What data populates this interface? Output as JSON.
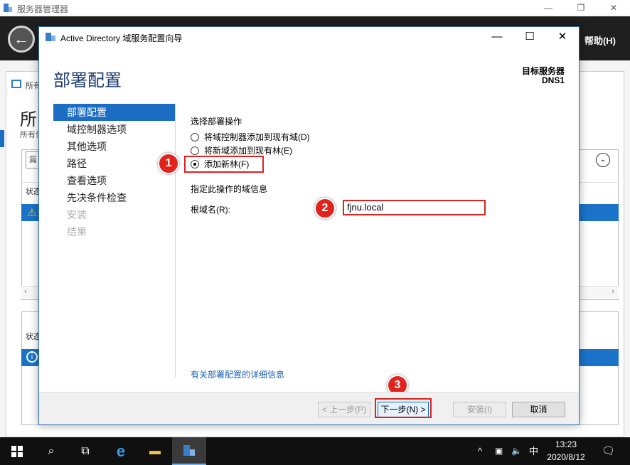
{
  "server_manager": {
    "title": "服务器管理器",
    "help_menu": "帮助(H)",
    "panel_label": "所有",
    "big_title": "所",
    "sub_title": "所有伺",
    "filter_placeholder": "篇",
    "status_col": "状态",
    "status_col2": "状态"
  },
  "wizard": {
    "window_title": "Active Directory 域服务配置向导",
    "page_title": "部署配置",
    "target_label": "目标服务器",
    "target_name": "DNS1",
    "nav": [
      {
        "label": "部署配置",
        "state": "active"
      },
      {
        "label": "域控制器选项",
        "state": "normal"
      },
      {
        "label": "其他选项",
        "state": "normal"
      },
      {
        "label": "路径",
        "state": "normal"
      },
      {
        "label": "查看选项",
        "state": "normal"
      },
      {
        "label": "先决条件检查",
        "state": "normal"
      },
      {
        "label": "安装",
        "state": "disabled"
      },
      {
        "label": "结果",
        "state": "disabled"
      }
    ],
    "operation_heading": "选择部署操作",
    "options": [
      {
        "label": "将域控制器添加到现有域(D)",
        "selected": false
      },
      {
        "label": "将新域添加到现有林(E)",
        "selected": false
      },
      {
        "label": "添加新林(F)",
        "selected": true
      }
    ],
    "domain_info_heading": "指定此操作的域信息",
    "root_domain_label": "根域名(R):",
    "root_domain_value": "fjnu.local",
    "more_info_link": "有关部署配置的详细信息",
    "buttons": {
      "prev": "< 上一步(P)",
      "next": "下一步(N) >",
      "install": "安装(I)",
      "cancel": "取消"
    },
    "badges": [
      "1",
      "2",
      "3"
    ]
  },
  "taskbar": {
    "time": "13:23",
    "date": "2020/8/12",
    "ime": "中"
  }
}
